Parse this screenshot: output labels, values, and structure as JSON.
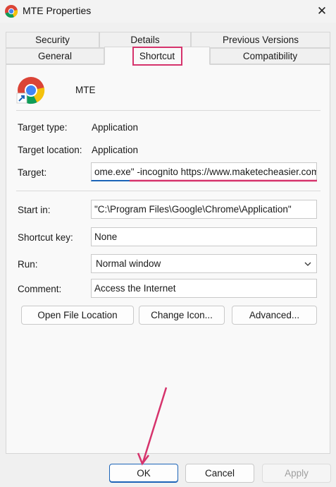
{
  "window": {
    "title": "MTE Properties",
    "close_glyph": "✕"
  },
  "tabs_top": [
    "Security",
    "Details",
    "Previous Versions"
  ],
  "tabs_bottom": [
    "General",
    "Shortcut",
    "Compatibility"
  ],
  "active_tab": "Shortcut",
  "shortcut_name": "MTE",
  "target_type": {
    "label": "Target type:",
    "value": "Application"
  },
  "target_location": {
    "label": "Target location:",
    "value": "Application"
  },
  "target": {
    "label": "Target:",
    "value": "ome.exe\" -incognito https://www.maketecheasier.com/"
  },
  "start_in": {
    "label": "Start in:",
    "value": "\"C:\\Program Files\\Google\\Chrome\\Application\""
  },
  "shortcut_key": {
    "label": "Shortcut key:",
    "value": "None"
  },
  "run": {
    "label": "Run:",
    "value": "Normal window"
  },
  "comment": {
    "label": "Comment:",
    "value": "Access the Internet"
  },
  "action_buttons": {
    "open_file_location": "Open File Location",
    "change_icon": "Change Icon...",
    "advanced": "Advanced..."
  },
  "footer_buttons": {
    "ok": "OK",
    "cancel": "Cancel",
    "apply": "Apply"
  },
  "colors": {
    "highlight": "#d6336c",
    "accent_blue": "#1c64b8",
    "chrome_red": "#db4437",
    "chrome_yellow": "#f4c20d",
    "chrome_green": "#0f9d58",
    "chrome_blue": "#4285f4"
  },
  "icons": {
    "app": "chrome-shortcut-icon",
    "close": "close-icon",
    "dropdown": "chevron-down-icon"
  }
}
